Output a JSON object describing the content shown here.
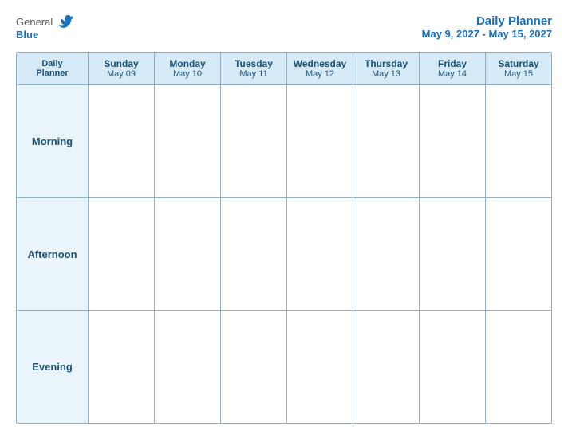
{
  "header": {
    "logo": {
      "general": "General",
      "blue": "Blue",
      "bird_unicode": "🔵"
    },
    "title": "Daily Planner",
    "dates": "May 9, 2027 - May 15, 2027"
  },
  "calendar": {
    "row_labels": [
      "Daily\nPlanner",
      "Morning",
      "Afternoon",
      "Evening"
    ],
    "columns": [
      {
        "day": "Sunday",
        "date": "May 09"
      },
      {
        "day": "Monday",
        "date": "May 10"
      },
      {
        "day": "Tuesday",
        "date": "May 11"
      },
      {
        "day": "Wednesday",
        "date": "May 12"
      },
      {
        "day": "Thursday",
        "date": "May 13"
      },
      {
        "day": "Friday",
        "date": "May 14"
      },
      {
        "day": "Saturday",
        "date": "May 15"
      }
    ],
    "time_rows": [
      "Morning",
      "Afternoon",
      "Evening"
    ]
  }
}
